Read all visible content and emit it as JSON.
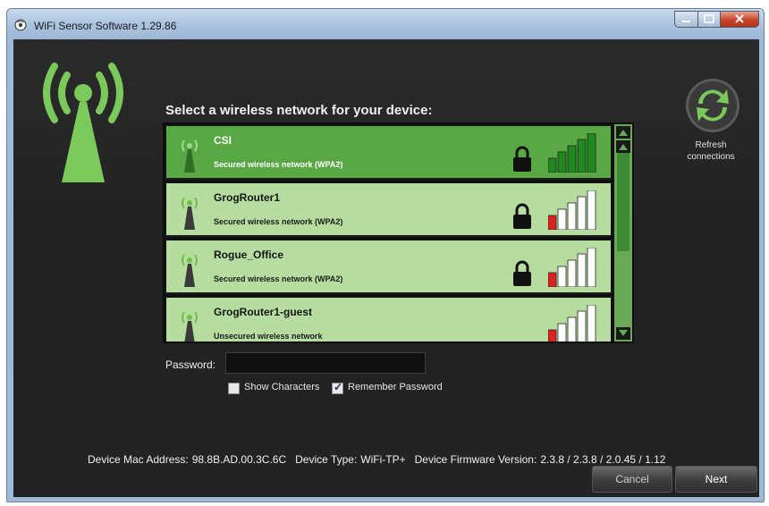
{
  "window": {
    "title": "WiFi Sensor Software 1.29.86"
  },
  "heading": "Select a wireless network for your device:",
  "networks": [
    {
      "name": "CSI",
      "security": "Secured wireless network (WPA2)",
      "selected": true,
      "signal_bars": 5,
      "locked": true
    },
    {
      "name": "GrogRouter1",
      "security": "Secured wireless network (WPA2)",
      "selected": false,
      "signal_bars": 1,
      "locked": true
    },
    {
      "name": "Rogue_Office",
      "security": "Secured wireless network (WPA2)",
      "selected": false,
      "signal_bars": 1,
      "locked": true
    },
    {
      "name": "GrogRouter1-guest",
      "security": "Unsecured wireless network",
      "selected": false,
      "signal_bars": 1,
      "locked": false
    }
  ],
  "password": {
    "label": "Password:",
    "value": ""
  },
  "options": {
    "show_characters": {
      "label": "Show Characters",
      "checked": false
    },
    "remember_password": {
      "label": "Remember Password",
      "checked": true
    }
  },
  "device": {
    "mac_label": "Device Mac Address:",
    "mac_value": "98.8B.AD.00.3C.6C",
    "type_label": "Device Type:",
    "type_value": "WiFi-TP+",
    "firmware_label": "Device Firmware Version:",
    "firmware_value": "2.3.8 / 2.3.8 / 2.0.45 / 1.12"
  },
  "buttons": {
    "cancel": "Cancel",
    "next": "Next"
  },
  "refresh": {
    "line1": "Refresh",
    "line2": "connections"
  },
  "colors": {
    "accent_green": "#6fbf4f",
    "selected_row": "#5aa845",
    "row": "#b6dd9f",
    "weak_signal": "#e02020",
    "strong_signal": "#1e8a1e"
  }
}
